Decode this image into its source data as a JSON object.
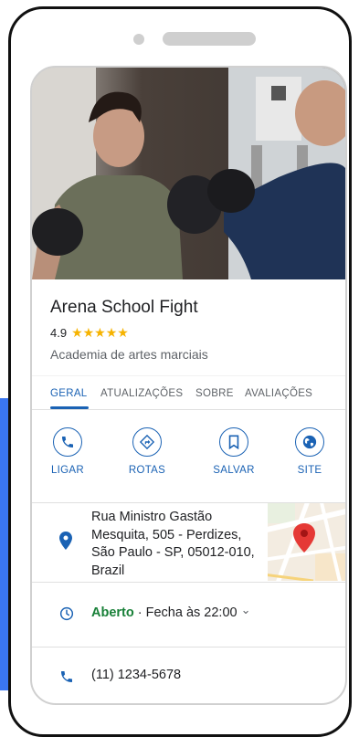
{
  "place": {
    "name": "Arena School Fight",
    "rating": "4.9",
    "stars": "★★★★★",
    "category": "Academia de artes marciais"
  },
  "tabs": [
    "GERAL",
    "ATUALIZAÇÕES",
    "SOBRE",
    "AVALIAÇÕES"
  ],
  "actions": {
    "call": "LIGAR",
    "directions": "ROTAS",
    "save": "SALVAR",
    "website": "SITE"
  },
  "address": {
    "line1": "Rua Ministro Gastão",
    "line2": "Mesquita, 505 - Perdizes,",
    "line3": "São Paulo - SP, 05012-010,",
    "line4": "Brazil"
  },
  "hours": {
    "status": "Aberto",
    "separator": " · ",
    "closes": "Fecha às 22:00",
    "chevron": "⌄"
  },
  "phone": "(11) 1234-5678",
  "colors": {
    "accent": "#1a62b4",
    "open": "#188038",
    "star": "#f6b300",
    "map_pin": "#e53935"
  },
  "icons": {
    "call": "phone-icon",
    "directions": "directions-icon",
    "save": "bookmark-icon",
    "website": "globe-icon",
    "address": "location-pin-icon",
    "hours": "clock-icon",
    "phone": "phone-icon"
  }
}
